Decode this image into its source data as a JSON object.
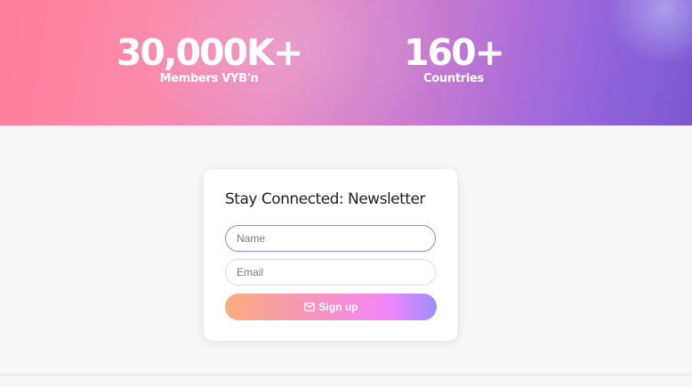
{
  "stats": {
    "members": {
      "value": "30,000K+",
      "label": "Members VYB'n"
    },
    "countries": {
      "value": "160+",
      "label": "Countries"
    }
  },
  "newsletter": {
    "title": "Stay Connected: Newsletter",
    "name_placeholder": "Name",
    "email_placeholder": "Email",
    "signup_label": "Sign up",
    "signup_icon": "mail-icon"
  },
  "colors": {
    "banner_start": "#fe7f9d",
    "banner_end": "#7a58d2",
    "button_start": "#fdac7e",
    "button_mid": "#ef86fb",
    "button_end": "#9d8ffb",
    "focus_border": "#8a86e6"
  }
}
